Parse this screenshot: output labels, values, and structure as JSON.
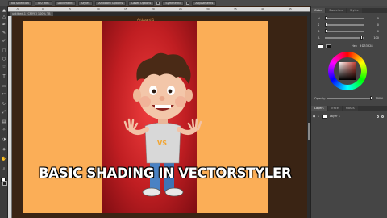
{
  "toolbar": {
    "items": [
      "No Selection",
      "0.0 mm",
      "Document",
      "Styles",
      "Artboard Options",
      "Laser Options",
      "Symmetric",
      "Adjustments"
    ]
  },
  "document": {
    "tab_label": "untitled-1 [CMYK] 100% TB"
  },
  "canvas": {
    "artboard_label": "Artboard 1",
    "title_text": "BASIC SHADING IN VECTORSTYLER",
    "colors": {
      "background": "#3a2414",
      "artboard": "#fbae57",
      "red_panel": "#c01e22"
    }
  },
  "character": {
    "shirt_text": "VS"
  },
  "ruler": {
    "ticks": [
      "-5",
      "0",
      "5",
      "10",
      "15",
      "20",
      "25",
      "30",
      "35",
      "40",
      "45"
    ]
  },
  "panel": {
    "color_tabs": [
      "Color",
      "Swatches",
      "Styles"
    ],
    "channels": [
      {
        "label": "H",
        "value": "0"
      },
      {
        "label": "S",
        "value": "0"
      },
      {
        "label": "B",
        "value": "0"
      },
      {
        "label": "A",
        "value": "100"
      }
    ],
    "hex_label": "Hex",
    "hex_value": "#D33328",
    "opacity_label": "Opacity",
    "opacity_value": "100%",
    "layer_tabs": [
      "Layers",
      "Trace",
      "Masks"
    ],
    "layers": [
      {
        "name": "Layer 1"
      }
    ]
  }
}
